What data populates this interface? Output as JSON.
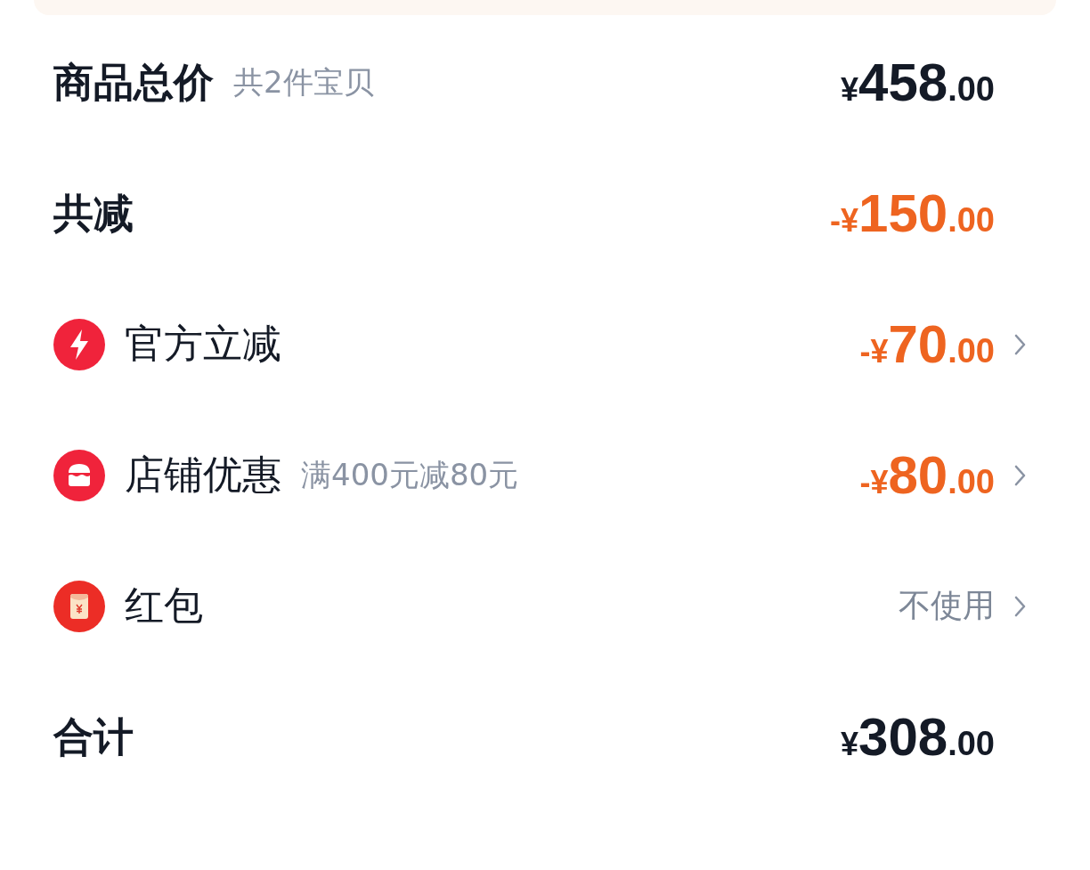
{
  "rows": [
    {
      "kind": "summary",
      "label": "商品总价",
      "note": "共2件宝贝",
      "amount": {
        "symbol": "¥",
        "whole": "458",
        "fraction": ".00"
      }
    },
    {
      "kind": "summary",
      "label": "共减",
      "amount": {
        "sign": "-",
        "symbol": "¥",
        "whole": "150",
        "fraction": ".00"
      }
    },
    {
      "kind": "bolt",
      "label": "官方立减",
      "amount": {
        "sign": "-",
        "symbol": "¥",
        "whole": "70",
        "fraction": ".00"
      }
    },
    {
      "kind": "shop",
      "label": "店铺优惠",
      "note": "满400元减80元",
      "amount": {
        "sign": "-",
        "symbol": "¥",
        "whole": "80",
        "fraction": ".00"
      }
    },
    {
      "kind": "envelope",
      "label": "红包",
      "value": "不使用"
    },
    {
      "kind": "summary",
      "label": "合计",
      "amount": {
        "symbol": "¥",
        "whole": "308",
        "fraction": ".00"
      }
    }
  ]
}
